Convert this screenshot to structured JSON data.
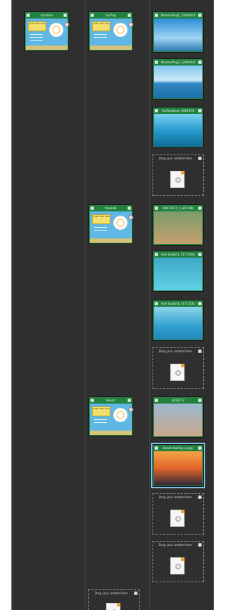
{
  "colors": {
    "canvas": "#2f2f2f",
    "card_header": "#22813e",
    "selection": "#7fc3ea"
  },
  "menus": {
    "vacation": {
      "title": "Vacation",
      "panel_text": "Enter title here"
    },
    "surfing": {
      "title": "Surfing",
      "panel_text": "Enter title here"
    },
    "poolside": {
      "title": "Poolside",
      "panel_text": "Enter title here"
    },
    "beach": {
      "title": "Beach",
      "panel_text": "Enter title here"
    }
  },
  "photos": [
    {
      "title": "Windsurfing1_12486419"
    },
    {
      "title": "Windsurfing2_12486426"
    },
    {
      "title": "Surfingwave_6062874"
    },
    {
      "title": "99971837_5_HD7480"
    },
    {
      "title": "Pool Splash1_71717804"
    },
    {
      "title": "Pool Splash3_71717181"
    },
    {
      "title": "8430177"
    },
    {
      "title": "Beach-holiday_Large"
    }
  ],
  "drop_zone": {
    "label": "Drag your content here"
  }
}
